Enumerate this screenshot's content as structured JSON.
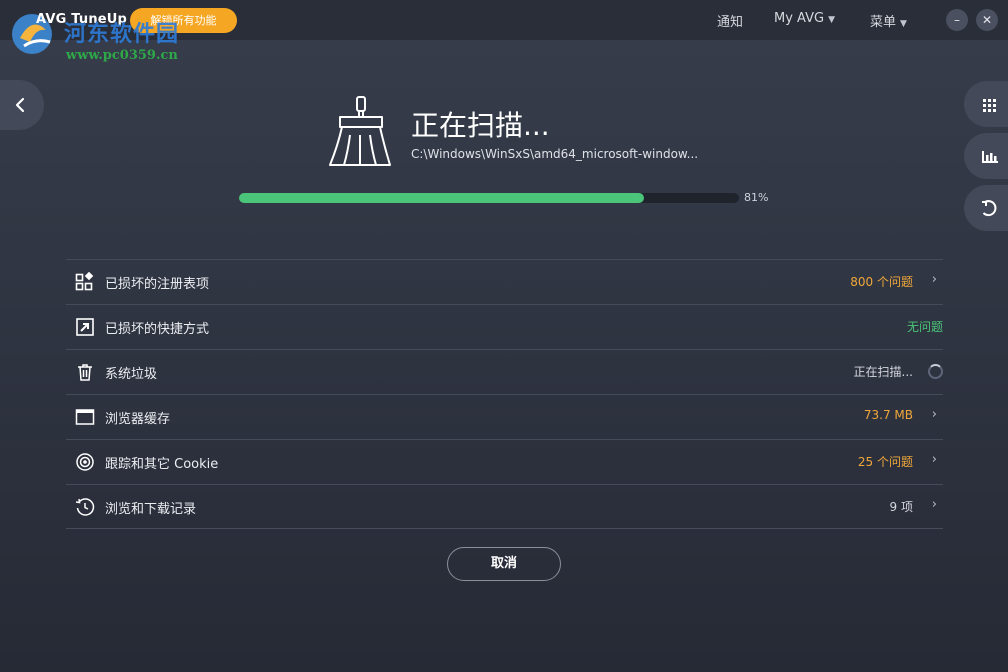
{
  "titlebar": {
    "brand": "AVG TuneUp",
    "unlock_label": "解锁所有功能",
    "watermark_title": "河东软件园",
    "watermark_url": "www.pc0359.cn",
    "nav": {
      "notifications": "通知",
      "my_avg": "My AVG",
      "menu": "菜单"
    },
    "minimize": "–",
    "close": "✕"
  },
  "scan": {
    "title": "正在扫描...",
    "path": "C:\\Windows\\WinSxS\\amd64_microsoft-window...",
    "progress": 0.81,
    "progress_label": "81%"
  },
  "items": [
    {
      "name": "registry",
      "icon": "registry-grid-icon",
      "label": "已损坏的注册表项",
      "value": "800 个问题",
      "status": "orange",
      "arrow": "›"
    },
    {
      "name": "shortcuts",
      "icon": "shortcut-arrow-icon",
      "label": "已损坏的快捷方式",
      "value": "无问题",
      "status": "green",
      "arrow": ""
    },
    {
      "name": "junk",
      "icon": "trash-icon",
      "label": "系统垃圾",
      "value": "正在扫描...",
      "status": "grey",
      "arrow": ""
    },
    {
      "name": "browser-cache",
      "icon": "browser-window-icon",
      "label": "浏览器缓存",
      "value": "73.7 MB",
      "status": "orange",
      "arrow": "›"
    },
    {
      "name": "cookies",
      "icon": "target-icon",
      "label": "跟踪和其它 Cookie",
      "value": "25 个问题",
      "status": "orange",
      "arrow": "›"
    },
    {
      "name": "history",
      "icon": "clock-history-icon",
      "label": "浏览和下载记录",
      "value": "9 项",
      "status": "grey",
      "arrow": "›"
    }
  ],
  "cancel_label": "取消",
  "colors": {
    "accent_green": "#4bc57a",
    "accent_orange": "#f0a73a",
    "unlock_orange": "#f5a623",
    "background": "#2e3340"
  }
}
